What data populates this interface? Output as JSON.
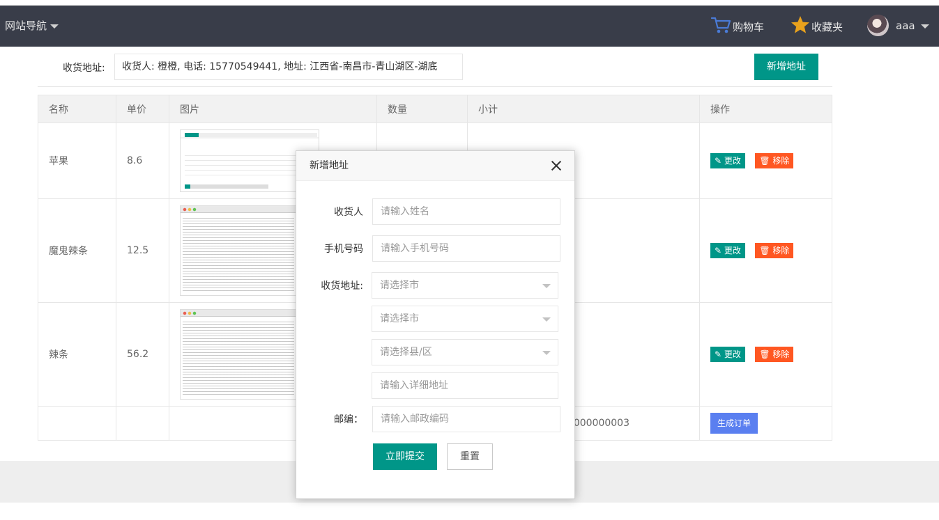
{
  "header": {
    "site_nav": "网站导航",
    "cart": "购物车",
    "favorites": "收藏夹",
    "username": "aaa",
    "colors": {
      "bg": "#393d49",
      "cart_icon": "#4a7bd6",
      "star_icon": "#e9a21c"
    }
  },
  "address": {
    "label": "收货地址:",
    "value": "收货人: 橙橙, 电话: 15770549441, 地址: 江西省-南昌市-青山湖区-湖底",
    "new_button": "新增地址"
  },
  "table": {
    "headers": [
      "名称",
      "单价",
      "图片",
      "数量",
      "小计",
      "操作"
    ],
    "rows": [
      {
        "name": "苹果",
        "price": "8.6"
      },
      {
        "name": "魔鬼辣条",
        "price": "12.5"
      },
      {
        "name": "辣条",
        "price": "56.2"
      }
    ],
    "edit_label": "更改",
    "delete_label": "移除",
    "total_partial": "0000000003",
    "order_button": "生成订单"
  },
  "modal": {
    "title": "新增地址",
    "name_label": "收货人",
    "name_placeholder": "请输入姓名",
    "phone_label": "手机号码",
    "phone_placeholder": "请输入手机号码",
    "addr_label": "收货地址:",
    "select1": "请选择市",
    "select2": "请选择市",
    "select3": "请选择县/区",
    "detail_placeholder": "请输入详细地址",
    "zip_label": "邮编：",
    "zip_placeholder": "请输入邮政编码",
    "submit": "立即提交",
    "reset": "重置"
  }
}
